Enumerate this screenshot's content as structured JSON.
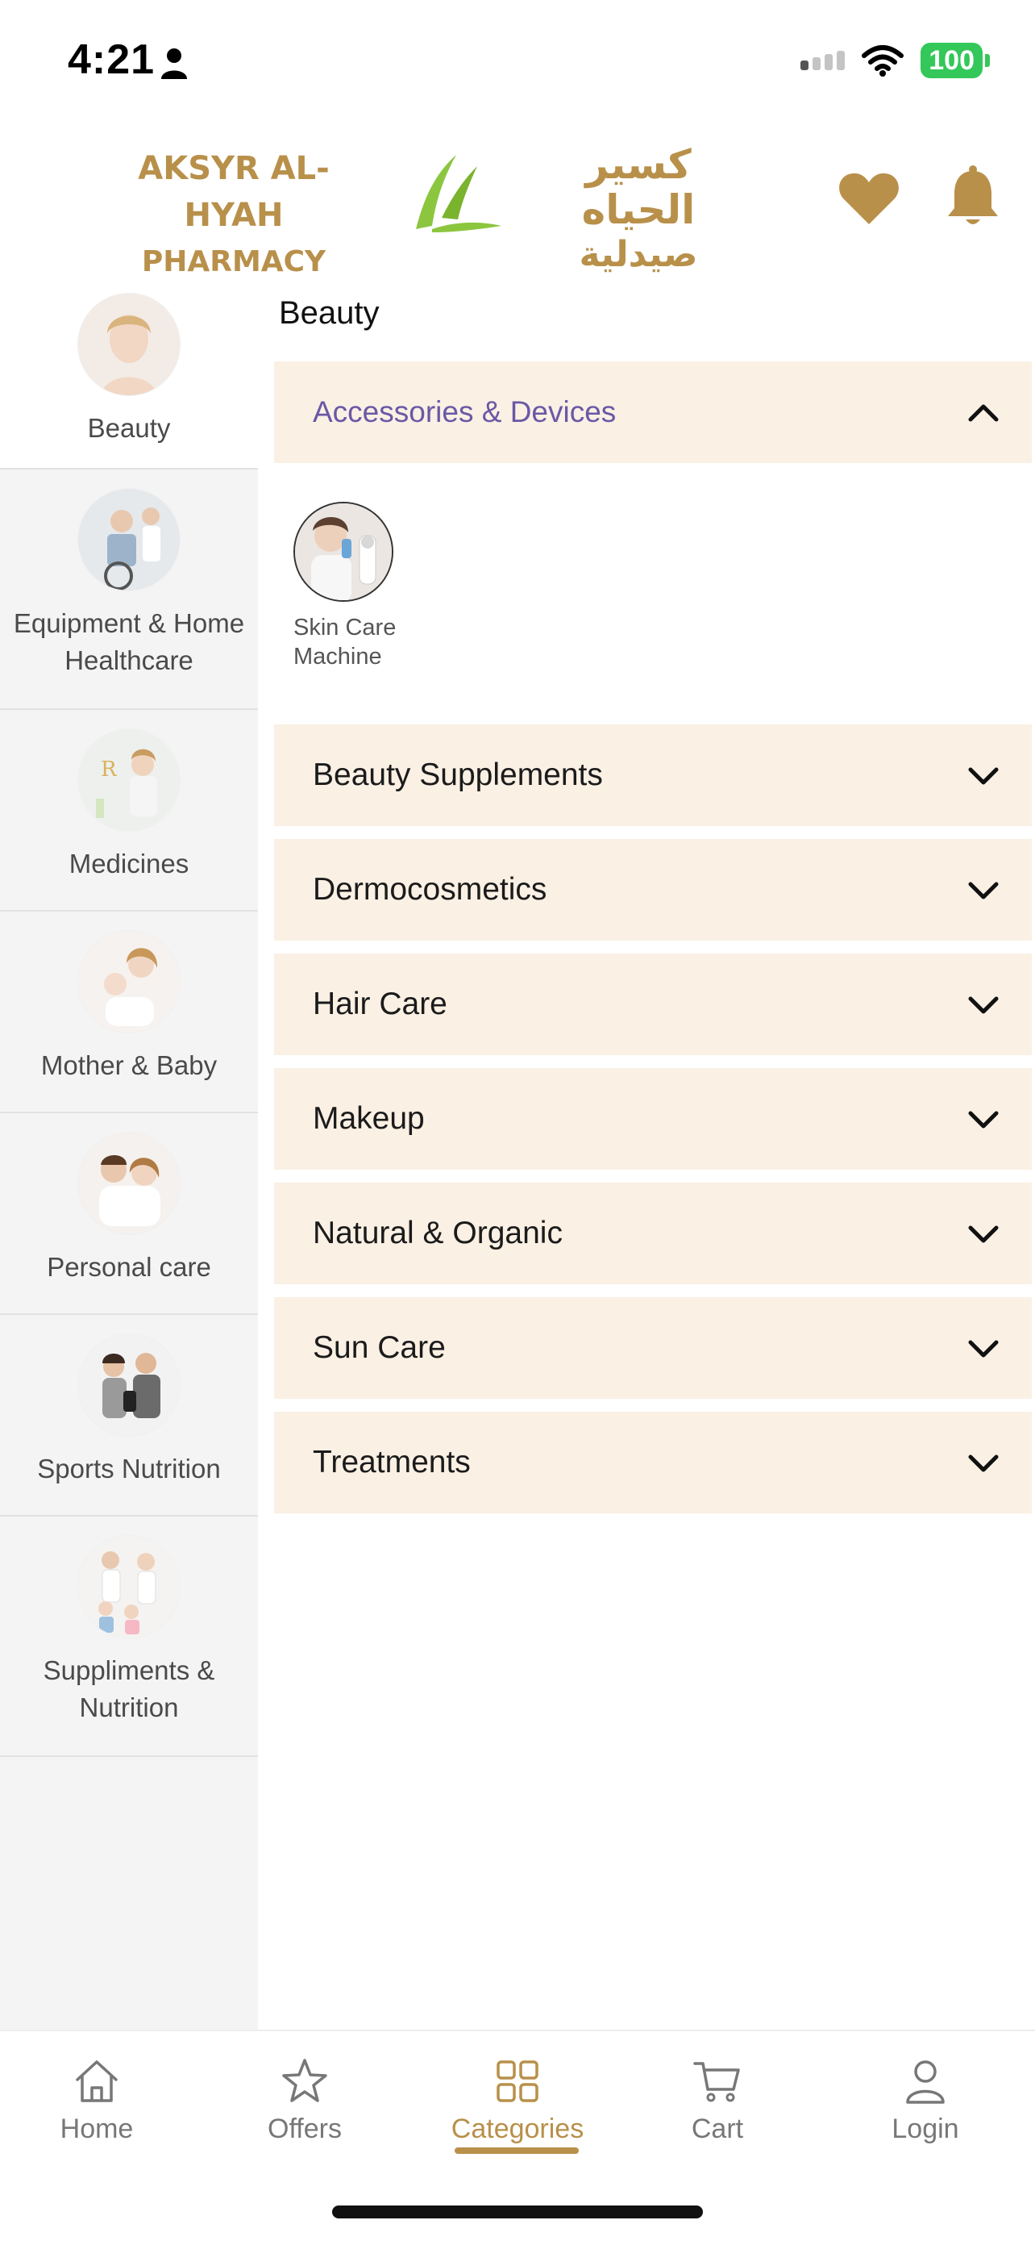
{
  "status_bar": {
    "time": "4:21",
    "battery": "100"
  },
  "header": {
    "brand_en_line1": "AKSYR AL-HYAH",
    "brand_en_line2": "PHARMACY",
    "brand_ar_line1": "كسير الحياه",
    "brand_ar_line2": "صيدلية",
    "accent_color": "#b8904a"
  },
  "sidebar": {
    "items": [
      {
        "label": "Beauty",
        "active": true
      },
      {
        "label": "Equipment & Home Healthcare"
      },
      {
        "label": "Medicines"
      },
      {
        "label": "Mother & Baby"
      },
      {
        "label": "Personal care"
      },
      {
        "label": "Sports Nutrition"
      },
      {
        "label": "Suppliments & Nutrition"
      }
    ]
  },
  "main": {
    "title": "Beauty",
    "accordions": [
      {
        "label": "Accessories & Devices",
        "expanded": true,
        "subitems": [
          {
            "label": "Skin Care Machine"
          }
        ]
      },
      {
        "label": "Beauty Supplements"
      },
      {
        "label": "Dermocosmetics"
      },
      {
        "label": "Hair Care"
      },
      {
        "label": "Makeup"
      },
      {
        "label": "Natural & Organic"
      },
      {
        "label": "Sun Care"
      },
      {
        "label": "Treatments"
      }
    ]
  },
  "bottom_nav": {
    "items": [
      {
        "label": "Home",
        "icon": "home-icon"
      },
      {
        "label": "Offers",
        "icon": "star-icon"
      },
      {
        "label": "Categories",
        "icon": "grid-icon",
        "active": true
      },
      {
        "label": "Cart",
        "icon": "cart-icon"
      },
      {
        "label": "Login",
        "icon": "user-icon"
      }
    ]
  }
}
